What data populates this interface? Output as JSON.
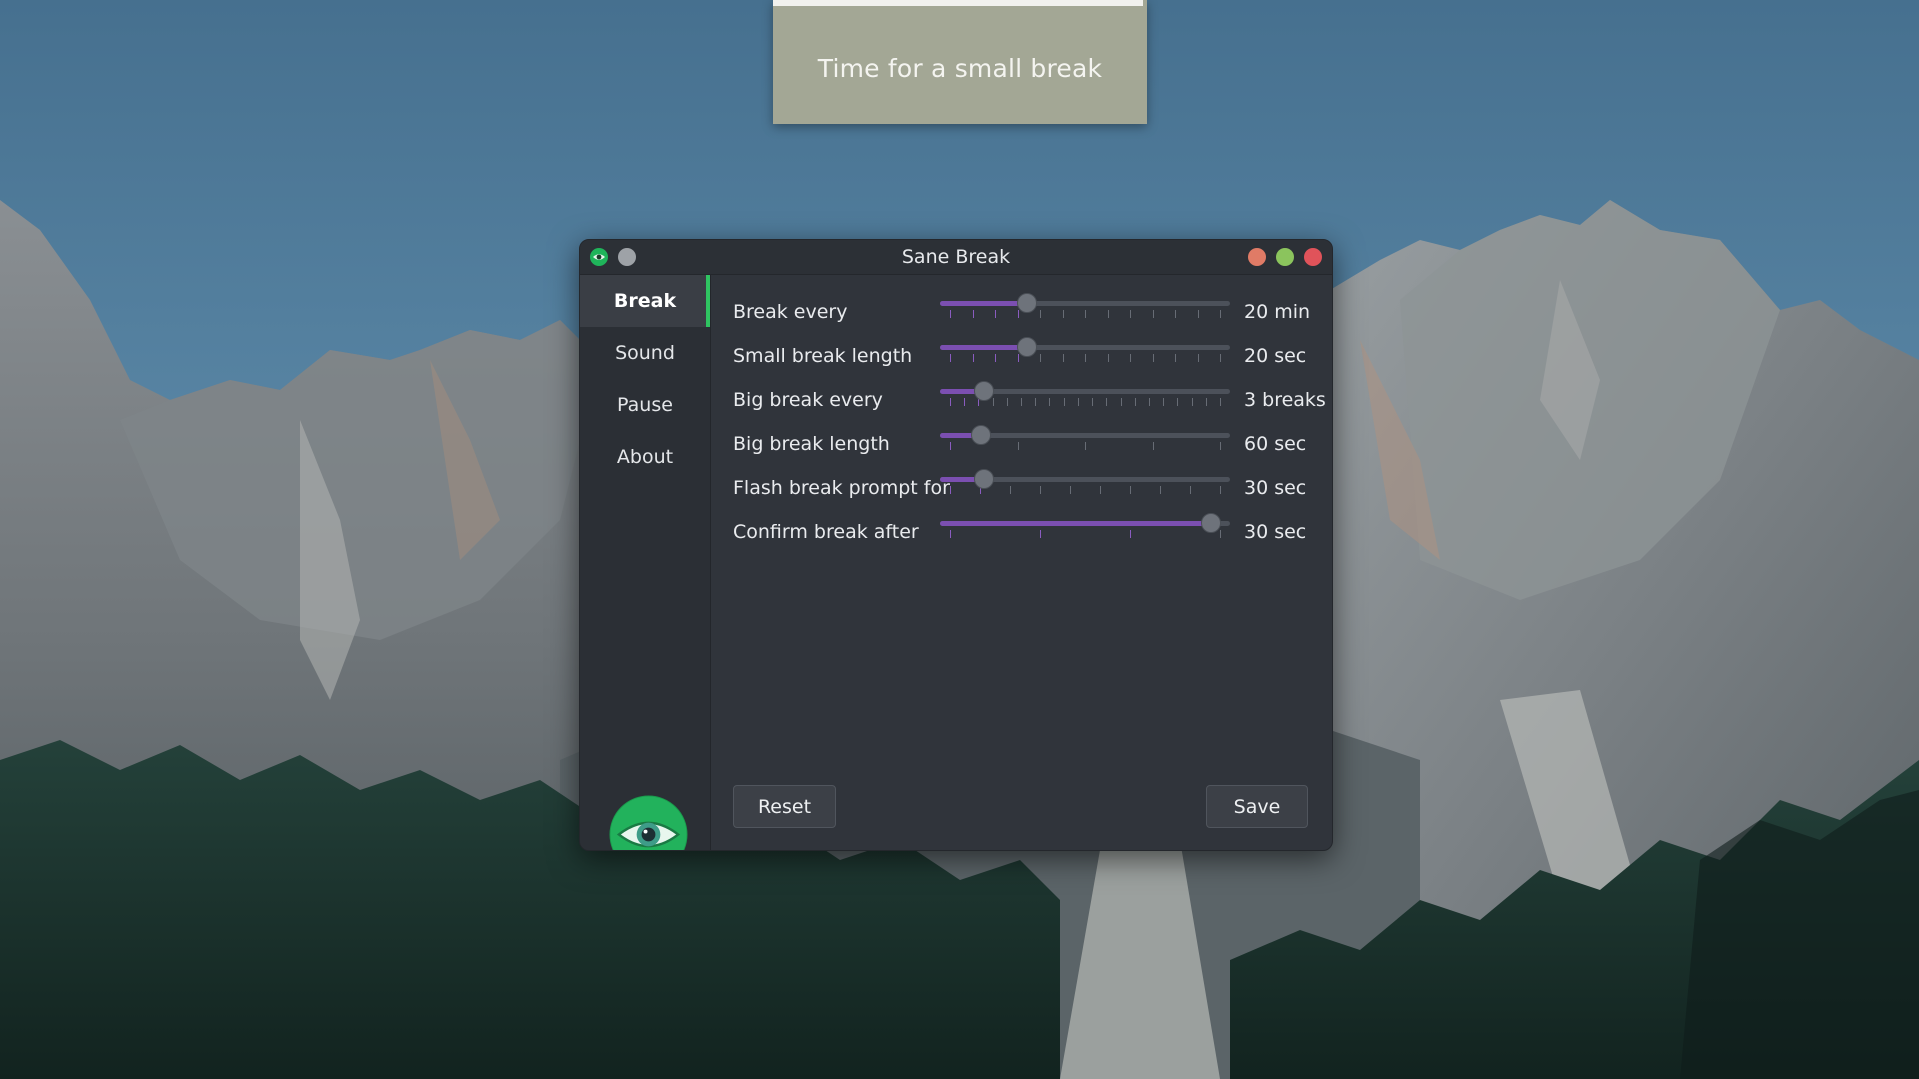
{
  "prompt": {
    "text": "Time for a small break",
    "progress_fraction": 0.99
  },
  "window": {
    "title": "Sane Break"
  },
  "sidebar": {
    "items": [
      {
        "label": "Break",
        "active": true
      },
      {
        "label": "Sound",
        "active": false
      },
      {
        "label": "Pause",
        "active": false
      },
      {
        "label": "About",
        "active": false
      }
    ]
  },
  "settings": [
    {
      "label": "Break every",
      "value": "20 min",
      "fraction": 0.29,
      "ticks": 13
    },
    {
      "label": "Small break length",
      "value": "20 sec",
      "fraction": 0.29,
      "ticks": 13
    },
    {
      "label": "Big break every",
      "value": "3 breaks",
      "fraction": 0.13,
      "ticks": 20
    },
    {
      "label": "Big break length",
      "value": "60 sec",
      "fraction": 0.12,
      "ticks": 5
    },
    {
      "label": "Flash break prompt for",
      "value": "30 sec",
      "fraction": 0.13,
      "ticks": 10
    },
    {
      "label": "Confirm break after",
      "value": "30 sec",
      "fraction": 0.96,
      "ticks": 4
    }
  ],
  "buttons": {
    "reset": "Reset",
    "save": "Save"
  },
  "colors": {
    "accent": "#7b4fb1",
    "active_indicator": "#2fc461",
    "prompt_bg": "#a3a795"
  }
}
